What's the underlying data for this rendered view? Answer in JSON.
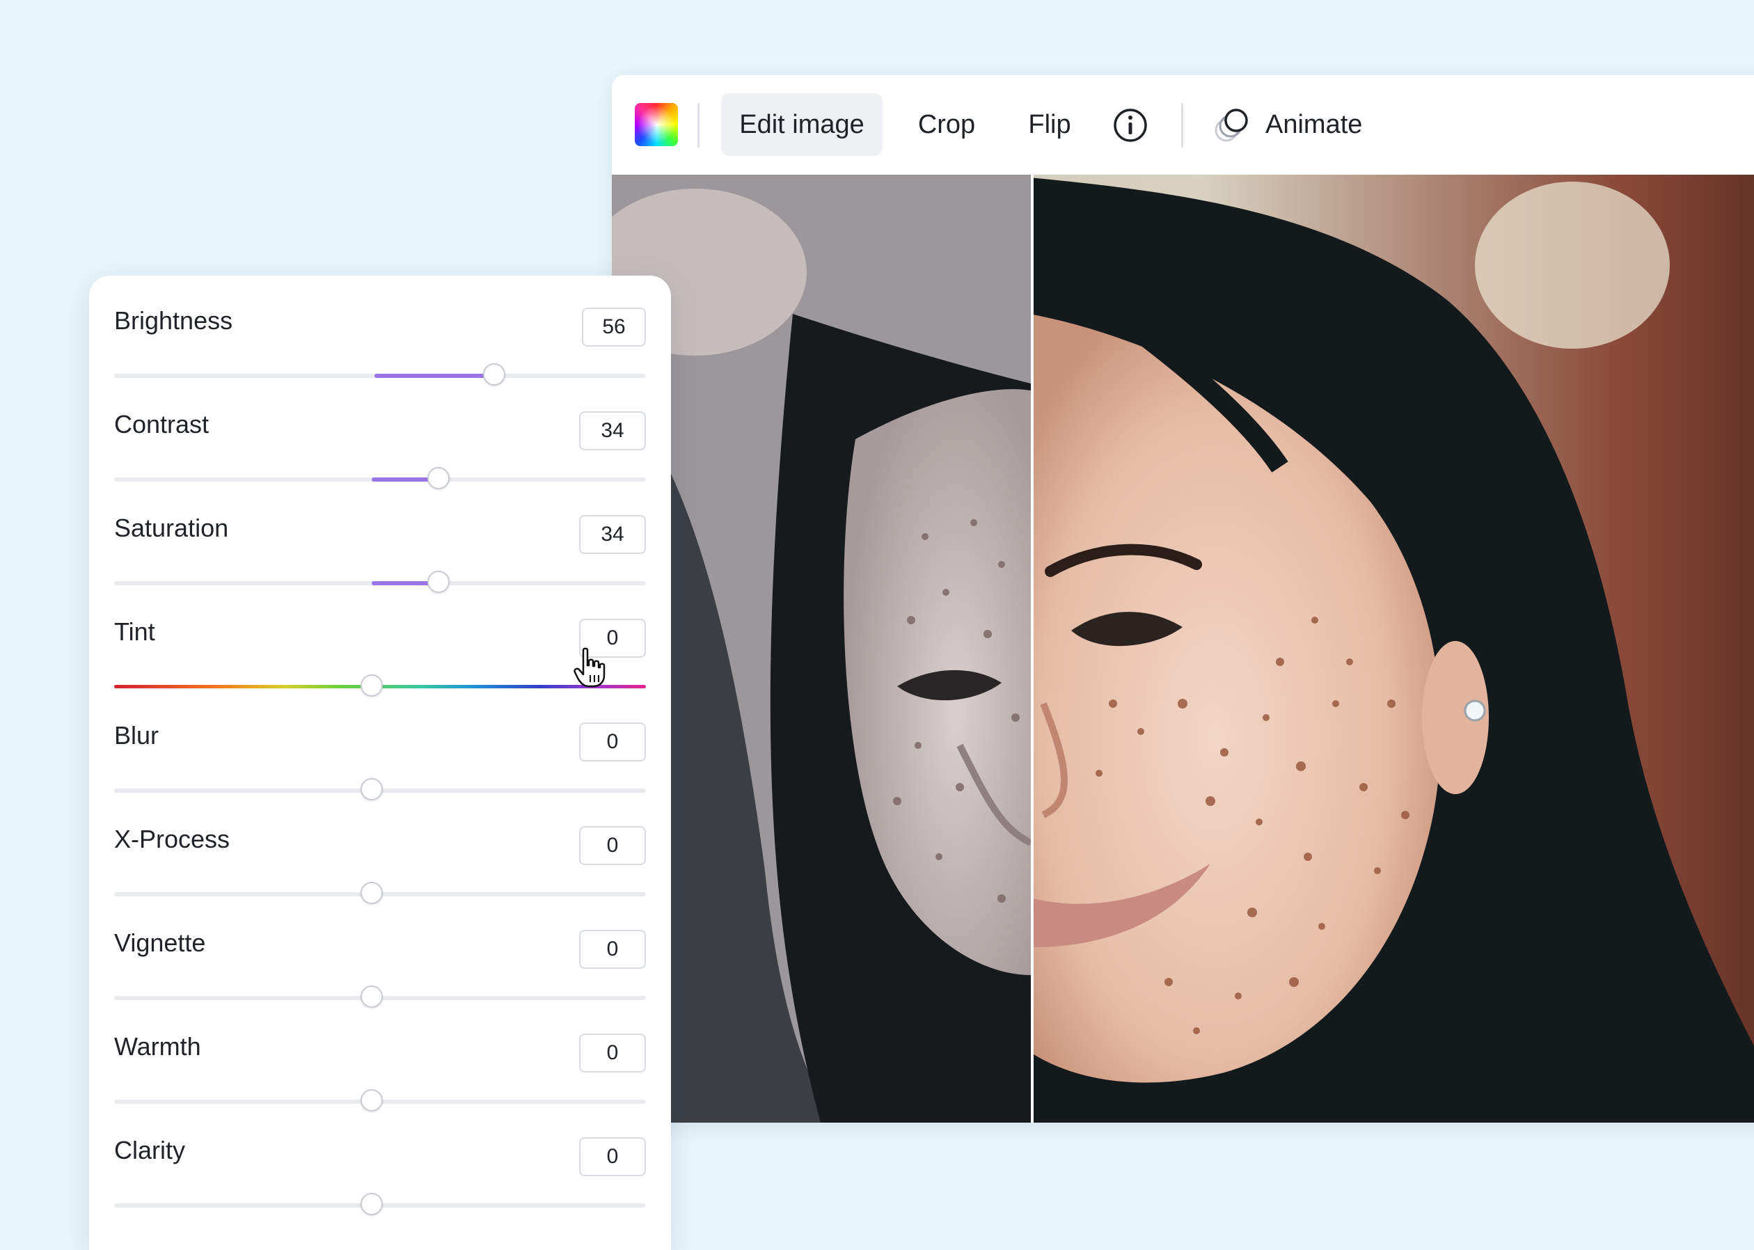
{
  "toolbar": {
    "color_icon": "color-wheel-icon",
    "edit_image_label": "Edit image",
    "crop_label": "Crop",
    "flip_label": "Flip",
    "info_icon": "info-icon",
    "animate_icon": "animate-icon",
    "animate_label": "Animate",
    "active_item": "Edit image"
  },
  "photo": {
    "description_icon": "before-after-split-photo",
    "split_position_fraction": 0.22
  },
  "adjust_panel": {
    "sliders": [
      {
        "label": "Brightness",
        "value": "56",
        "min": -100,
        "max": 100
      },
      {
        "label": "Contrast",
        "value": "34",
        "min": -100,
        "max": 100
      },
      {
        "label": "Saturation",
        "value": "34",
        "min": -100,
        "max": 100
      },
      {
        "label": "Tint",
        "value": "0",
        "min": -100,
        "max": 100
      },
      {
        "label": "Blur",
        "value": "0",
        "min": -100,
        "max": 100
      },
      {
        "label": "X-Process",
        "value": "0",
        "min": -100,
        "max": 100
      },
      {
        "label": "Vignette",
        "value": "0",
        "min": -100,
        "max": 100
      },
      {
        "label": "Warmth",
        "value": "0",
        "min": -100,
        "max": 100
      },
      {
        "label": "Clarity",
        "value": "0",
        "min": -100,
        "max": 100
      }
    ],
    "accent_color": "#9b74e8",
    "pointer_icon": "hand-pointer-icon"
  }
}
